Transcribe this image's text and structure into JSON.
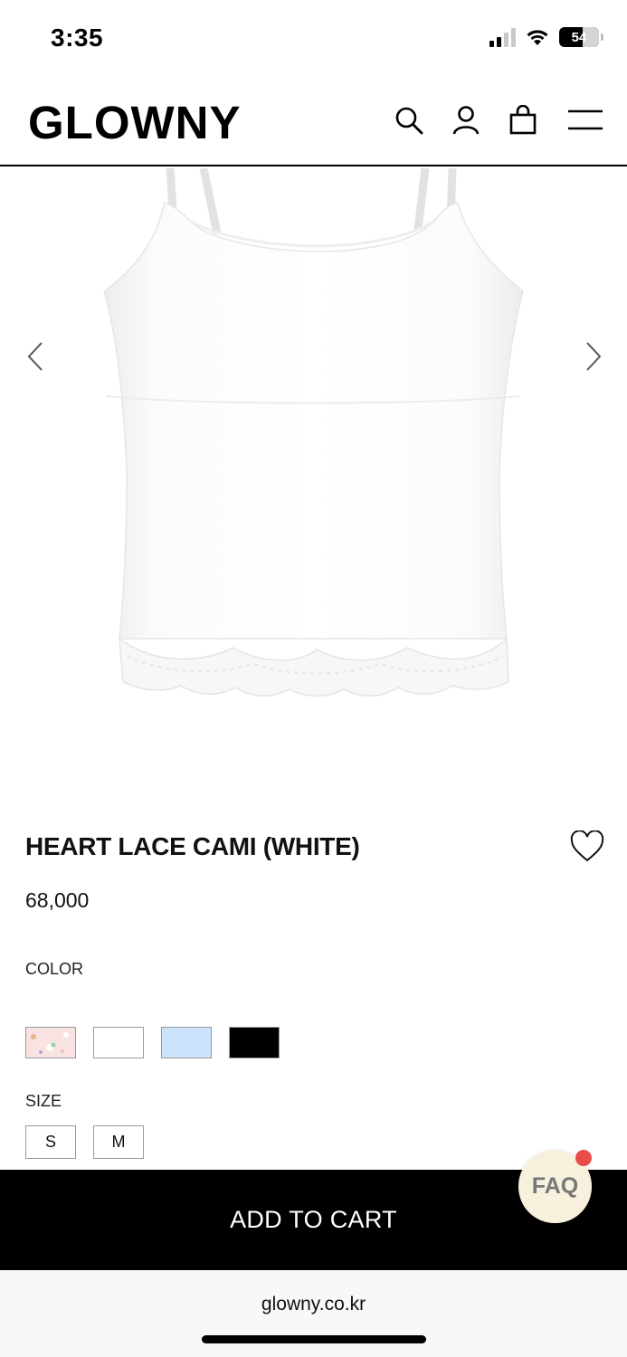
{
  "status_bar": {
    "time": "3:35",
    "battery": "54"
  },
  "header": {
    "logo": "GLOWNY",
    "icons": [
      "search-icon",
      "account-icon",
      "shopping-bag-icon",
      "menu-icon"
    ]
  },
  "gallery": {
    "image": "white-lace-camisole",
    "prev_icon": "chevron-left-icon",
    "next_icon": "chevron-right-icon"
  },
  "product": {
    "title": "HEART LACE CAMI (WHITE)",
    "price": "68,000",
    "color_label": "COLOR",
    "colors": [
      "#f9e2e2",
      "#ffffff",
      "#cbe3fb",
      "#000000"
    ],
    "size_label": "SIZE",
    "sizes": [
      "S",
      "M"
    ]
  },
  "actions": {
    "add_to_cart": "ADD TO CART",
    "faq": "FAQ"
  },
  "browser": {
    "url": "glowny.co.kr"
  }
}
